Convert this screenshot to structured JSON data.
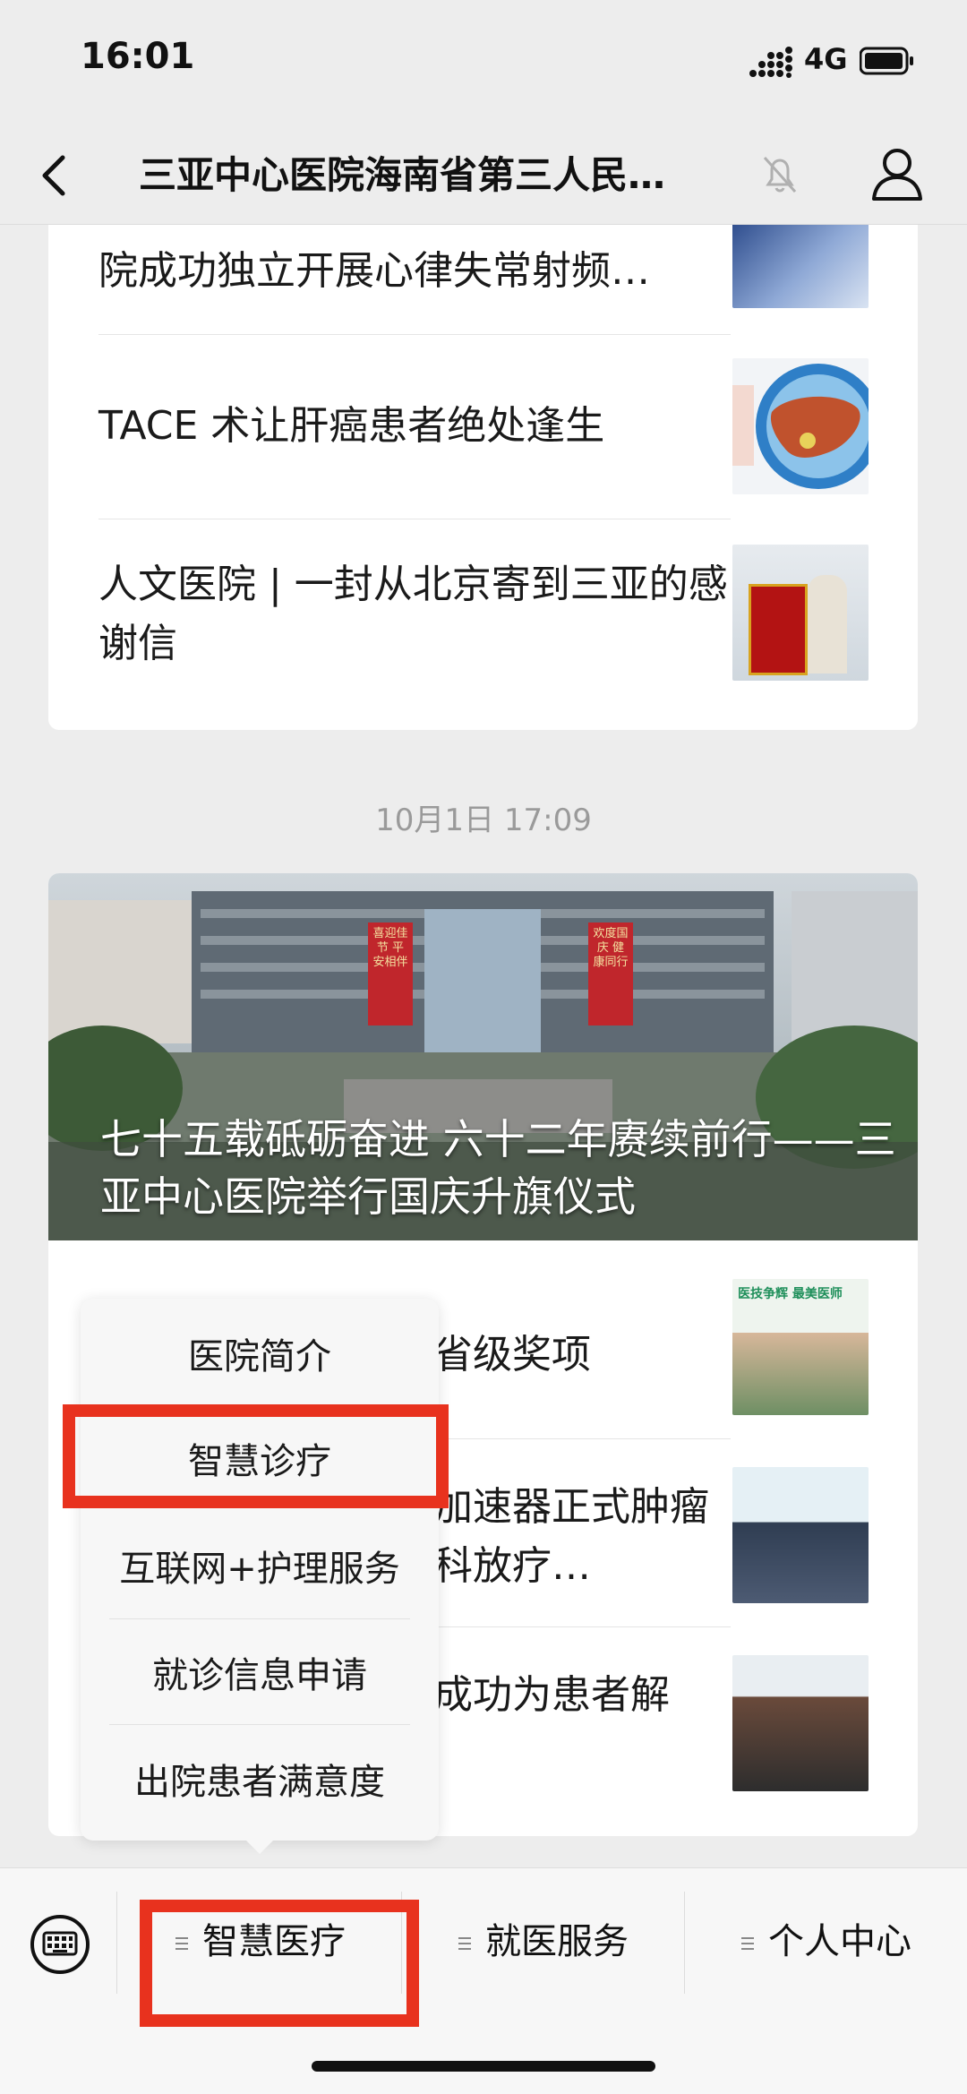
{
  "status_bar": {
    "time": "16:01",
    "network": "4G"
  },
  "nav": {
    "title": "三亚中心医院海南省第三人民…"
  },
  "card1": {
    "items": [
      {
        "title": "院成功独立开展心律失常射频…"
      },
      {
        "title": "TACE 术让肝癌患者绝处逢生"
      },
      {
        "title": "人文医院 | 一封从北京寄到三亚的感谢信"
      }
    ]
  },
  "date_label": "10月1日 17:09",
  "card2": {
    "banner_title": "七十五载砥砺奋进 六十二年赓续前行——三亚中心医院举行国庆升旗仪式",
    "banner_text_left": "喜迎佳节 平安相伴",
    "banner_text_right": "欢度国庆 健康同行",
    "items": [
      {
        "title": "省级奖项"
      },
      {
        "title": "加速器正式肿瘤科放疗…"
      },
      {
        "title": "成功为患者解"
      }
    ],
    "thumb1_caption": "医技争辉 最美医师"
  },
  "popup_menu": {
    "items": [
      "医院简介",
      "智慧诊疗",
      "互联网+护理服务",
      "就诊信息申请",
      "出院患者满意度"
    ]
  },
  "bottom_menu": {
    "tabs": [
      "智慧医疗",
      "就医服务",
      "个人中心"
    ]
  },
  "colors": {
    "highlight": "#e8321e",
    "background": "#ededed"
  }
}
